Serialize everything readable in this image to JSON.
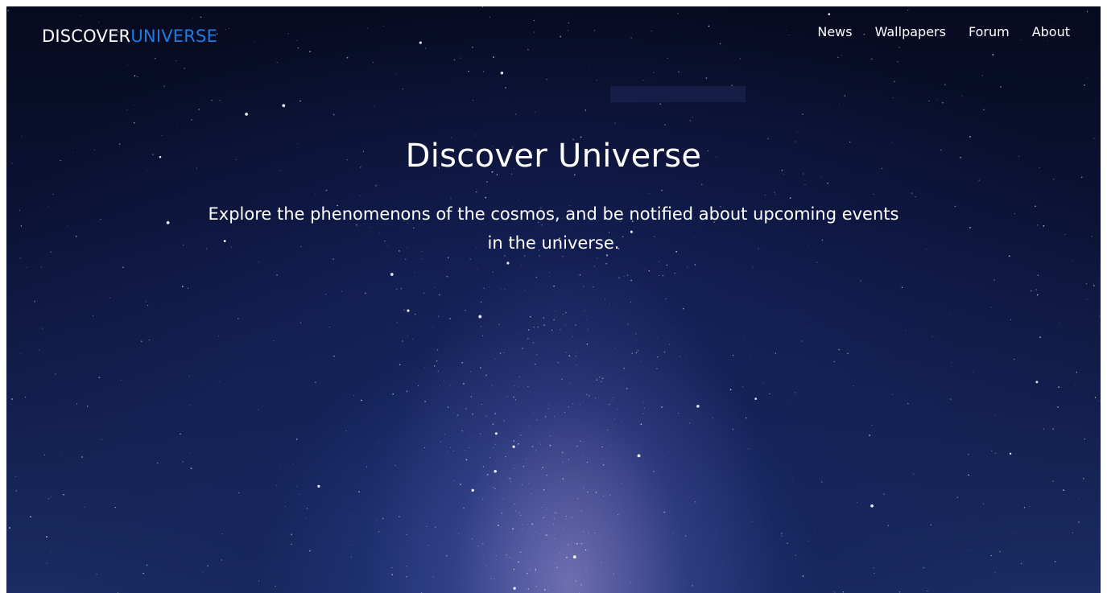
{
  "nav": {
    "logo_primary": "DISCOVER",
    "logo_accent": "UNIVERSE",
    "links": [
      "News",
      "Wallpapers",
      "Forum",
      "About"
    ]
  },
  "hero": {
    "title": "Discover Universe",
    "subtitle": "Explore the phenomenons of the cosmos, and be notified about upcoming events in the universe."
  },
  "colors": {
    "accent": "#1e7be0",
    "background_dark": "#070a1f",
    "background_glow": "#1a2c63"
  }
}
